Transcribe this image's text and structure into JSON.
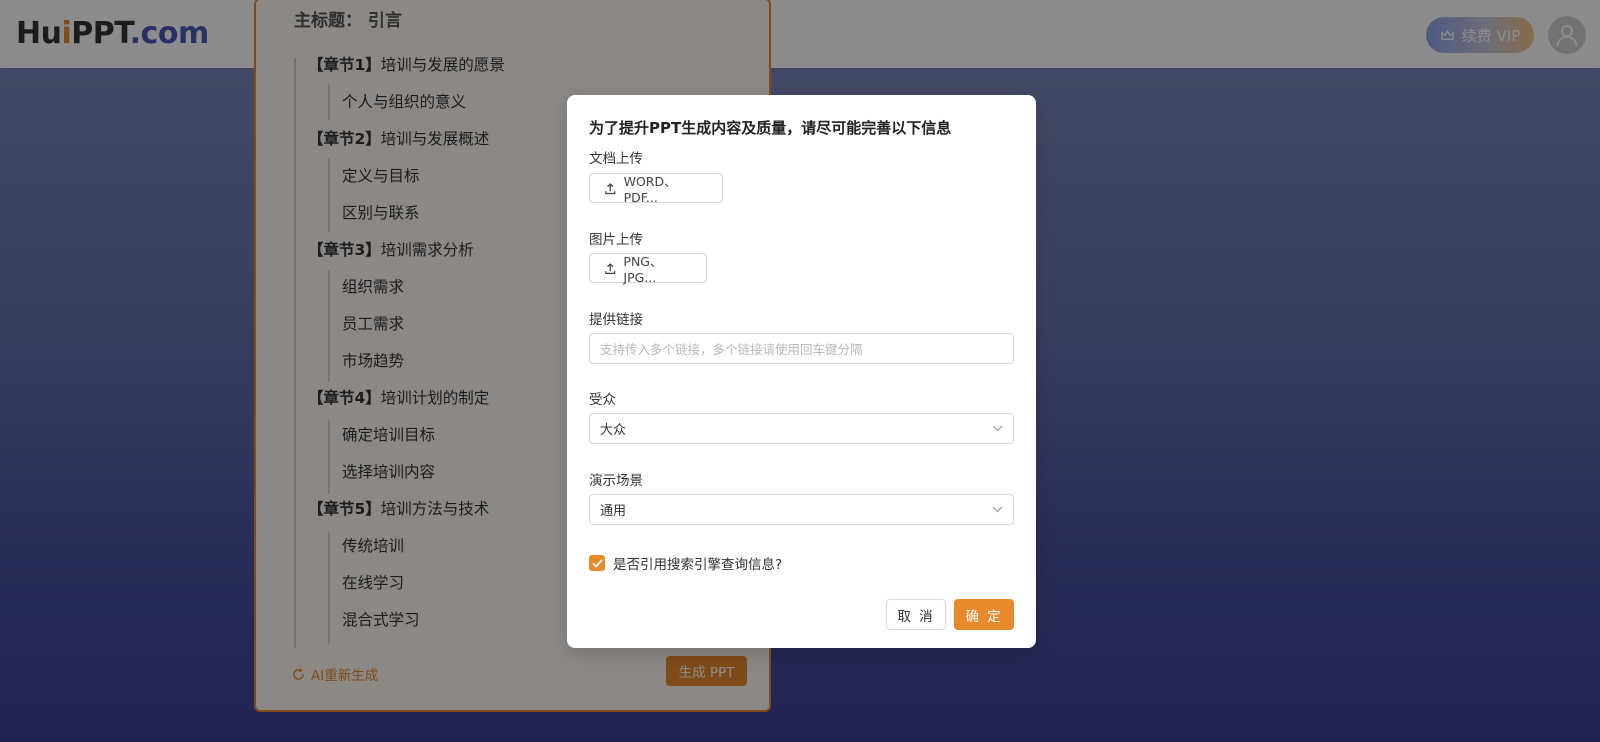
{
  "header": {
    "logo": {
      "part1": "Hu",
      "part2": "i",
      "part3": "PPT",
      "part4": ".com"
    },
    "vip_label": "续费 VIP",
    "avatar_icon": "user-icon"
  },
  "outline": {
    "main_title": "主标题：  引言",
    "chapters": [
      {
        "tag": "【章节1】",
        "title": "培训与发展的愿景",
        "subs": [
          "个人与组织的意义"
        ]
      },
      {
        "tag": "【章节2】",
        "title": "培训与发展概述",
        "subs": [
          "定义与目标",
          "区别与联系"
        ]
      },
      {
        "tag": "【章节3】",
        "title": "培训需求分析",
        "subs": [
          "组织需求",
          "员工需求",
          "市场趋势"
        ]
      },
      {
        "tag": "【章节4】",
        "title": "培训计划的制定",
        "subs": [
          "确定培训目标",
          "选择培训内容"
        ]
      },
      {
        "tag": "【章节5】",
        "title": "培训方法与技术",
        "subs": [
          "传统培训",
          "在线学习",
          "混合式学习"
        ]
      }
    ],
    "regen_label": "AI重新生成",
    "generate_label": "生成 PPT"
  },
  "modal": {
    "title": "为了提升PPT生成内容及质量，请尽可能完善以下信息",
    "doc_upload": {
      "label": "文档上传",
      "button": "WORD、PDF..."
    },
    "image_upload": {
      "label": "图片上传",
      "button": "PNG、JPG..."
    },
    "link": {
      "label": "提供链接",
      "placeholder": "支持传入多个链接，多个链接请使用回车键分隔"
    },
    "audience": {
      "label": "受众",
      "value": "大众"
    },
    "scene": {
      "label": "演示场景",
      "value": "通用"
    },
    "search_checkbox": {
      "label": "是否引用搜索引擎查询信息?",
      "checked": true
    },
    "cancel_label": "取 消",
    "ok_label": "确 定"
  },
  "colors": {
    "accent": "#e8892c",
    "brand_blue": "#4a58b6"
  }
}
